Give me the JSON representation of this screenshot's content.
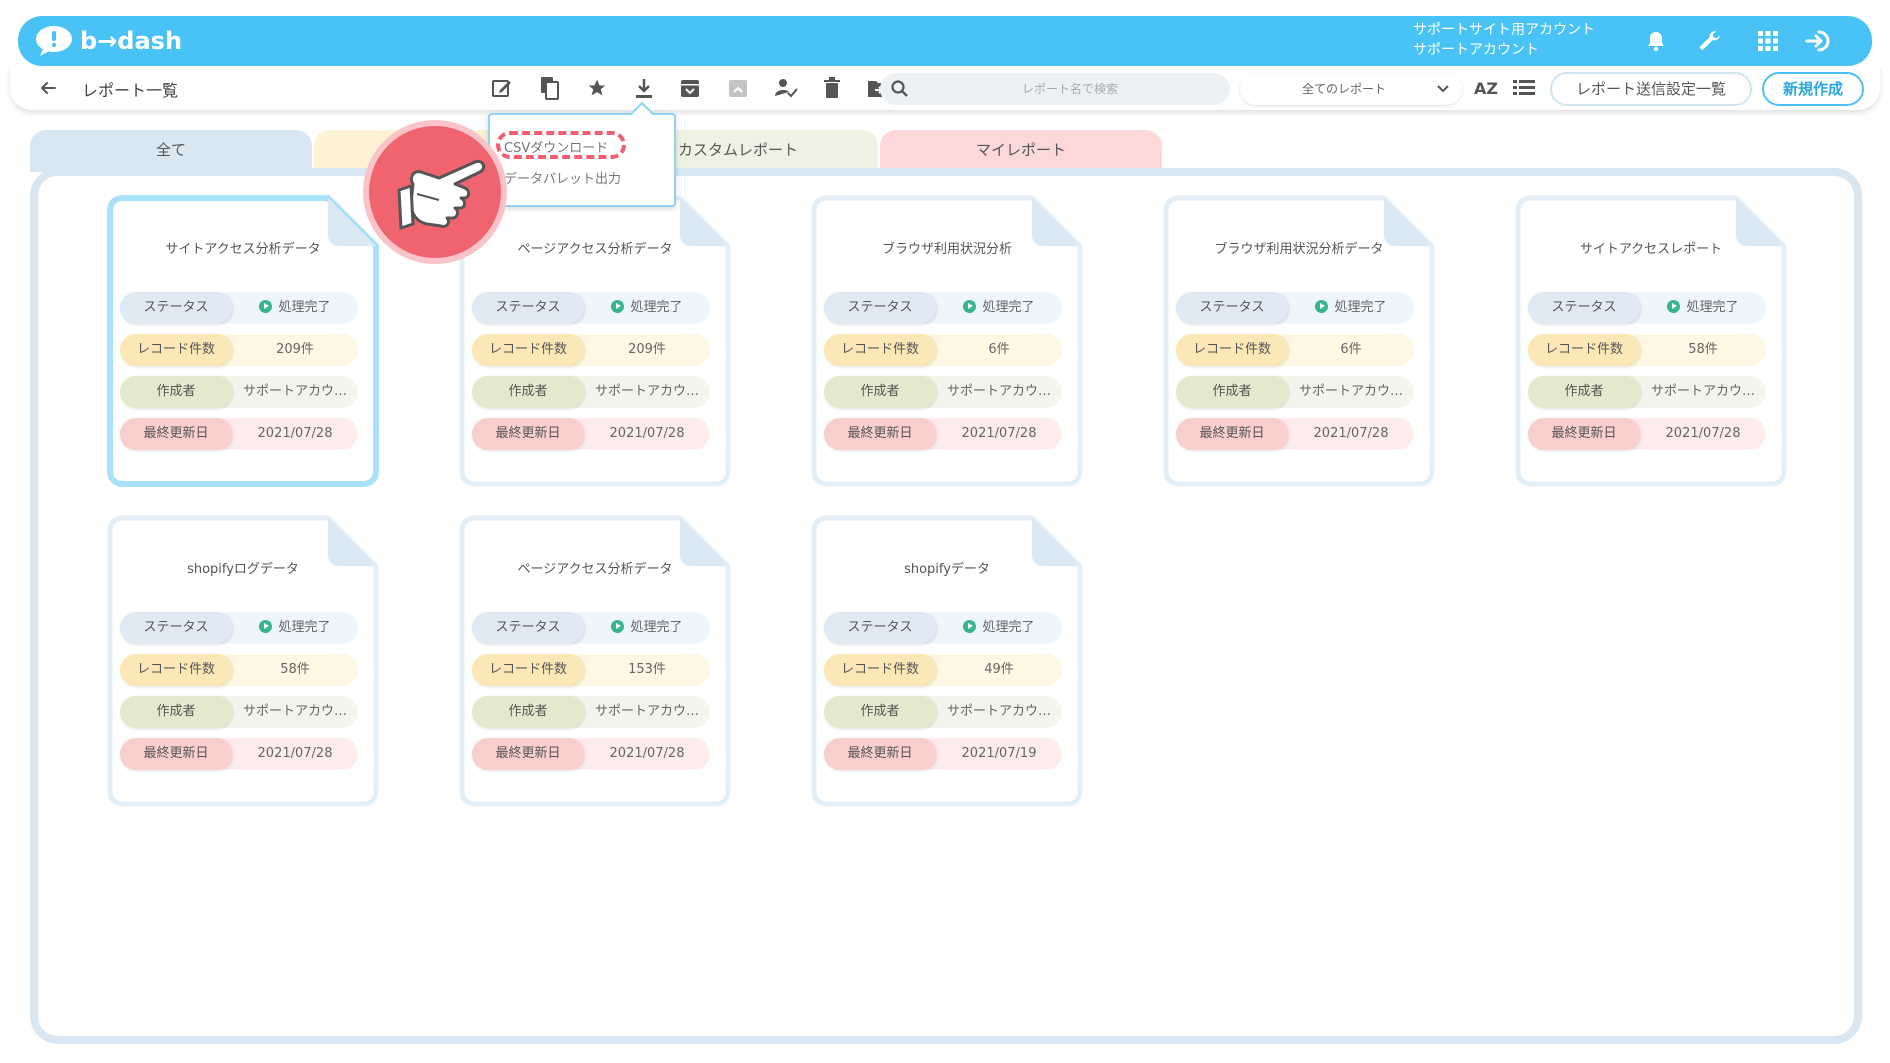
{
  "header": {
    "logo_text": "b→dash",
    "account_line1": "サポートサイト用アカウント",
    "account_line2": "サポートアカウント"
  },
  "subbar": {
    "title": "レポート一覧",
    "search_placeholder": "レポート名で検索",
    "filter_value": "全てのレポート",
    "sort_label": "AZ",
    "send_settings_button": "レポート送信設定一覧",
    "new_button": "新規作成"
  },
  "tabs": [
    {
      "label": "全て"
    },
    {
      "label": ""
    },
    {
      "label": "カスタムレポート"
    },
    {
      "label": "マイレポート"
    }
  ],
  "popup": {
    "items": [
      "CSVダウンロード",
      "データパレット出力"
    ]
  },
  "row_labels": {
    "status": "ステータス",
    "records": "レコード件数",
    "creator": "作成者",
    "updated": "最終更新日"
  },
  "cards": [
    {
      "title": "サイトアクセス分析データ",
      "status": "処理完了",
      "records": "209件",
      "creator": "サポートアカウ…",
      "updated": "2021/07/28"
    },
    {
      "title": "ページアクセス分析データ",
      "status": "処理完了",
      "records": "209件",
      "creator": "サポートアカウ…",
      "updated": "2021/07/28"
    },
    {
      "title": "ブラウザ利用状況分析",
      "status": "処理完了",
      "records": "6件",
      "creator": "サポートアカウ…",
      "updated": "2021/07/28"
    },
    {
      "title": "ブラウザ利用状況分析データ",
      "status": "処理完了",
      "records": "6件",
      "creator": "サポートアカウ…",
      "updated": "2021/07/28"
    },
    {
      "title": "サイトアクセスレポート",
      "status": "処理完了",
      "records": "58件",
      "creator": "サポートアカウ…",
      "updated": "2021/07/28"
    },
    {
      "title": "shopifyログデータ",
      "status": "処理完了",
      "records": "58件",
      "creator": "サポートアカウ…",
      "updated": "2021/07/28"
    },
    {
      "title": "ページアクセス分析データ",
      "status": "処理完了",
      "records": "153件",
      "creator": "サポートアカウ…",
      "updated": "2021/07/28"
    },
    {
      "title": "shopifyデータ",
      "status": "処理完了",
      "records": "49件",
      "creator": "サポートアカウ…",
      "updated": "2021/07/19"
    }
  ],
  "colors": {
    "brand": "#49c3f5",
    "selected_card_border": "#a9e0fa",
    "highlight": "#f15f6e",
    "status_ok": "#36b58f"
  }
}
